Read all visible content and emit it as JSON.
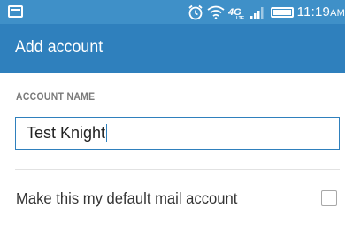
{
  "status_bar": {
    "time": "11:19",
    "ampm": "AM",
    "icons": [
      "image-notification-icon",
      "alarm-icon",
      "wifi-icon",
      "lte-icon",
      "signal-icon",
      "battery-icon"
    ]
  },
  "app_bar": {
    "title": "Add account"
  },
  "form": {
    "account_name_label": "ACCOUNT NAME",
    "account_name_value": "Test Knight",
    "default_account_label": "Make this my default mail account",
    "default_account_checked": false
  },
  "colors": {
    "status_bar": "#3f90c8",
    "app_bar": "#2f80bd",
    "accent": "#2f80bd"
  }
}
